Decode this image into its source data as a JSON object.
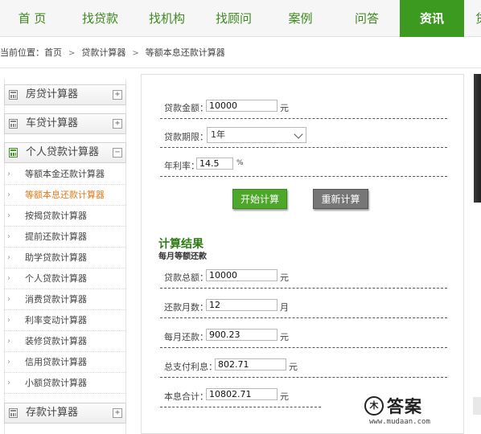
{
  "nav": {
    "items": [
      "首 页",
      "找贷款",
      "找机构",
      "找顾问",
      "案例",
      "问答",
      "资讯",
      "贷"
    ],
    "active_index": 6,
    "accent_color": "#3c9a21"
  },
  "breadcrumb": {
    "prefix": "当前位置：",
    "items": [
      "首页",
      "贷款计算器",
      "等额本息还款计算器"
    ],
    "separator": ">"
  },
  "sidebar": {
    "groups": [
      {
        "label": "房贷计算器",
        "toggle": "+"
      },
      {
        "label": "车贷计算器",
        "toggle": "+"
      },
      {
        "label": "个人贷款计算器",
        "toggle": "−"
      }
    ],
    "sub_items": [
      "等额本金还款计算器",
      "等额本息还款计算器",
      "按揭贷款计算器",
      "提前还款计算器",
      "助学贷款计算器",
      "个人贷款计算器",
      "消费贷款计算器",
      "利率变动计算器",
      "装修贷款计算器",
      "信用贷款计算器",
      "小额贷款计算器"
    ],
    "active_sub_index": 1,
    "active_color": "#e07a1a",
    "bottom_group": {
      "label": "存款计算器",
      "toggle": "+"
    }
  },
  "form": {
    "amount": {
      "label": "贷款金额：",
      "value": "10000",
      "unit": "元"
    },
    "term": {
      "label": "贷款期限：",
      "value": "1年"
    },
    "rate": {
      "label": "年利率：",
      "value": "14.5",
      "unit": "%"
    },
    "start_button": "开始计算",
    "reset_button": "重新计算"
  },
  "result": {
    "title": "计算结果",
    "subtitle": "每月等额还款",
    "rows": [
      {
        "label": "贷款总额：",
        "value": "10000",
        "unit": "元"
      },
      {
        "label": "还款月数：",
        "value": "12",
        "unit": "月"
      },
      {
        "label": "每月还款：",
        "value": "900.23",
        "unit": "元"
      },
      {
        "label": "总支付利息：",
        "value": "802.71",
        "unit": "元"
      },
      {
        "label": "本息合计：",
        "value": "10802.71",
        "unit": "元"
      }
    ]
  },
  "watermark": {
    "logo_char": "木",
    "text": "答案",
    "url": "www.mudaan.com"
  }
}
